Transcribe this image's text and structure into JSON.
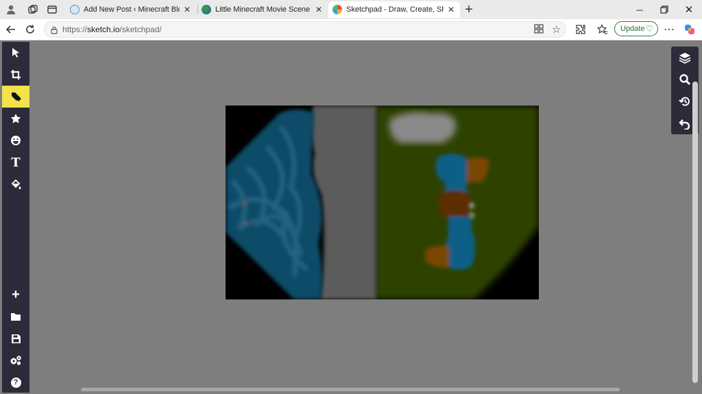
{
  "browser": {
    "tabs": [
      {
        "title": "Add New Post ‹ Minecraft Blog —",
        "favicon": "wordpress-icon",
        "active": false
      },
      {
        "title": "Little Minecraft Movie Scene Scrip",
        "favicon": "globe-icon",
        "active": false
      },
      {
        "title": "Sketchpad - Draw, Create, Share!",
        "favicon": "sketchpad-icon",
        "active": true
      }
    ],
    "url_prefix": "https://",
    "url_domain": "sketch.io",
    "url_path": "/sketchpad/",
    "update_label": "Update"
  },
  "app": {
    "left_tools": [
      "select-tool",
      "crop-tool",
      "brush-tool",
      "stamp-tool",
      "emoji-tool",
      "text-tool",
      "fill-tool"
    ],
    "active_tool": "brush-tool",
    "bottom_tools": [
      "new-tool",
      "open-tool",
      "save-tool",
      "settings-tool",
      "help-tool"
    ],
    "text_tool_glyph": "T",
    "help_glyph": "?",
    "right_tools": [
      "layers-tool",
      "zoom-tool",
      "history-tool",
      "undo-tool"
    ],
    "colors": {
      "toolbar_bg": "#2b2b3a",
      "active_tool_bg": "#f3e24a",
      "workspace_bg": "#7e7e7e",
      "canvas_bg": "#000000",
      "water": "#0a4f6e",
      "road": "#5e5e5e",
      "grass": "#344a00",
      "cloud": "#8a8a8a",
      "character_blue": "#0b5f86",
      "character_brown": "#5b2e06",
      "character_orange": "#7a4600"
    }
  }
}
